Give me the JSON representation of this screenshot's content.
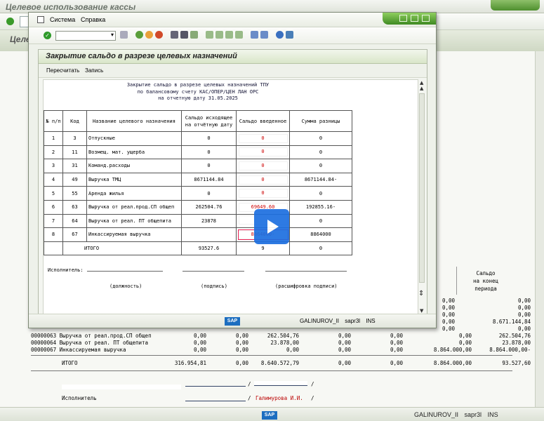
{
  "background": {
    "title": "Целевое использование кассы",
    "header_title": "Целев",
    "list_column_header": "Сальдо\nна конец\nпериода",
    "list_rows": [
      {
        "text": "",
        "col1": "0,00",
        "col2": "0,00"
      },
      {
        "text": "",
        "col1": "0,00",
        "col2": "0,00"
      },
      {
        "text": "",
        "col1": "0,00",
        "col2": "0,00"
      },
      {
        "text": "",
        "col1": "0,00",
        "col2": "8.671.144,84"
      },
      {
        "text": "",
        "col1": "0,00",
        "col2": "0,00"
      },
      {
        "text": "00000063 Выручка от реал.прод.СП общеп",
        "v1": "0,00",
        "v2": "0,00",
        "v3": "262.504,76",
        "v4": "0,00",
        "v5": "0,00",
        "v6": "0,00",
        "v7": "262.504,76"
      },
      {
        "text": "00000064 Выручка от реал. ПТ общепита",
        "v1": "0,00",
        "v2": "0,00",
        "v3": "23.878,00",
        "v4": "0,00",
        "v5": "0,00",
        "v6": "0,00",
        "v7": "23.878,00"
      },
      {
        "text": "00000067 Инкассируемая выручка",
        "v1": "0,00",
        "v2": "0,00",
        "v3": "0,00",
        "v4": "0,00",
        "v5": "0,00",
        "v6": "8.864.000,00",
        "v7": "8.864.000,00-"
      }
    ],
    "total": {
      "label": "ИТОГО",
      "v1": "316.954,81",
      "v2": "0,00",
      "v3": "8.640.572,79",
      "v4": "0,00",
      "v5": "0,00",
      "v6": "8.864.000,00",
      "v7": "93.527,60"
    },
    "executor_label": "Исполнитель",
    "executor_name": "Галимурова И.И.",
    "sign_sep": "/",
    "status": {
      "user": "GALINUROV_II",
      "server": "sapr3l",
      "mode": "INS"
    }
  },
  "dialog": {
    "menu": [
      "Система",
      "Справка"
    ],
    "title": "Закрытие сальдо в разрезе целевых назначений",
    "app_buttons": [
      "Пересчитать",
      "Запись"
    ],
    "report_title_lines": [
      "Закрытие сальдо в разрезе целевых назначений ТПУ",
      "по балансовому счету КАС/ОПЕР/ЦЕН ЛАН ОРС",
      "на отчетную дату 31.05.2025"
    ],
    "table_headers": [
      "№ п/п",
      "Код",
      "Название целевого назначения",
      "Сальдо исходящее на отчётную дату",
      "Сальдо введенное",
      "Сумма разницы"
    ],
    "rows": [
      {
        "n": "1",
        "code": "3",
        "name": "Отпускные",
        "out": "0",
        "in": "0",
        "diff": "0"
      },
      {
        "n": "2",
        "code": "11",
        "name": "Возмещ. мат. ущерба",
        "out": "0",
        "in": "0",
        "diff": "0"
      },
      {
        "n": "3",
        "code": "31",
        "name": "Команд.расходы",
        "out": "0",
        "in": "0",
        "diff": "0"
      },
      {
        "n": "4",
        "code": "49",
        "name": "Выручка ТМЦ",
        "out": "8671144.84",
        "in": "0",
        "diff": "8671144.84-"
      },
      {
        "n": "5",
        "code": "55",
        "name": "Аренда жилья",
        "out": "0",
        "in": "0",
        "diff": "0"
      },
      {
        "n": "6",
        "code": "63",
        "name": "Выручка от реал.прод.СП общеп",
        "out": "262504.76",
        "in": "69649.60",
        "diff": "192855.16-"
      },
      {
        "n": "7",
        "code": "64",
        "name": "Выручка от реал. ПТ общепита",
        "out": "23878",
        "in": "",
        "diff": "0"
      },
      {
        "n": "8",
        "code": "67",
        "name": "Инкассируемая выручка",
        "out": "",
        "in": "8864000-",
        "diff": "8864000"
      }
    ],
    "total": {
      "label": "ИТОГО",
      "out": "93527.6",
      "in": "9",
      "diff": "0"
    },
    "executor_label": "Исполнитель:",
    "signature_captions": [
      "(должность)",
      "(подпись)",
      "(расшифровка подписи)"
    ],
    "status": {
      "user": "GALINUROV_II",
      "server": "sapr3l",
      "mode": "INS"
    }
  },
  "colors": {
    "sap_green": "#4e8f2e",
    "sap_blue": "#1c6ec0",
    "input_red": "#c00000",
    "play_blue": "#1d6fe0"
  }
}
